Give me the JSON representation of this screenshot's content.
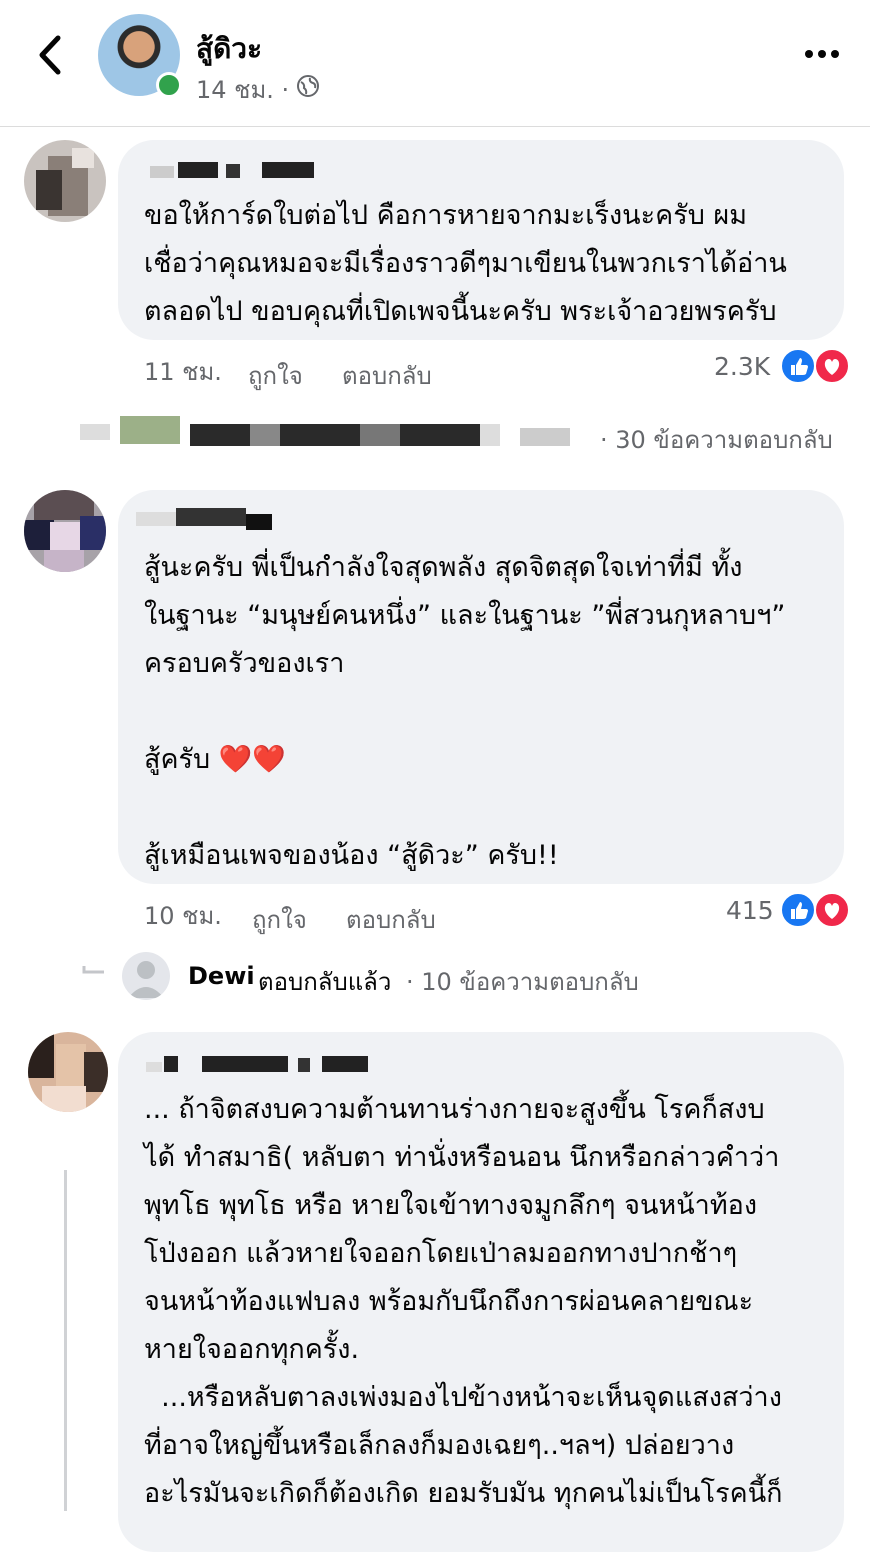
{
  "header": {
    "author": "สู้ดิวะ",
    "time": "14 ชม.",
    "dot": "·"
  },
  "comments": [
    {
      "text": "ขอให้การ์ดใบต่อไป คือการหายจากมะเร็งนะครับ ผม\nเชื่อว่าคุณหมอจะมีเรื่องราวดีๆมาเขียนในพวกเราได้อ่าน\nตลอดไป ขอบคุณที่เปิดเพจนี้นะครับ พระเจ้าอวยพรครับ",
      "time": "11 ชม.",
      "like_label": "ถูกใจ",
      "reply_label": "ตอบกลับ",
      "reactions_count": "2.3K",
      "replies_summary": "· 30 ข้อความตอบกลับ"
    },
    {
      "text": "สู้นะครับ พี่เป็นกำลังใจสุดพลัง สุดจิตสุดใจเท่าที่มี ทั้ง\nในฐานะ “มนุษย์คนหนึ่ง” และในฐานะ ”พี่สวนกุหลาบฯ”\nครอบครัวของเรา\n\nสู้ครับ ❤️❤️\n\nสู้เหมือนเพจของน้อง “สู้ดิวะ” ครับ!!",
      "time": "10 ชม.",
      "like_label": "ถูกใจ",
      "reply_label": "ตอบกลับ",
      "reactions_count": "415",
      "reply_author": "Dewi",
      "reply_action": "ตอบกลับแล้ว",
      "replies_summary": "· 10 ข้อความตอบกลับ"
    },
    {
      "text": "... ถ้าจิตสงบความต้านทานร่างกายจะสูงขึ้น โรคก็สงบ\nได้ ทำสมาธิ( หลับตา ท่านั่งหรือนอน นึกหรือกล่าวคำว่า\nพุทโธ พุทโธ หรือ หายใจเข้าทางจมูกลึกๆ จนหน้าท้อง\nโป่งออก แล้วหายใจออกโดยเป่าลมออกทางปากช้าๆ\nจนหน้าท้องแฟบลง พร้อมกับนึกถึงการผ่อนคลายขณะ\nหายใจออกทุกครั้ง.\n  ...หรือหลับตาลงเพ่งมองไปข้างหน้าจะเห็นจุดแสงสว่าง\nที่อาจใหญ่ขึ้นหรือเล็กลงก็มองเฉยๆ..ฯลฯ) ปล่อยวาง\nอะไรมันจะเกิดก็ต้องเกิด ยอมรับมัน ทุกคนไม่เป็นโรคนี้ก็"
    }
  ],
  "colors": {
    "bubble": "#f0f2f5",
    "secondary_text": "#65676b",
    "like": "#1877f2",
    "love": "#f0284a",
    "online": "#31a24c"
  },
  "icons": [
    "back-arrow-icon",
    "globe-icon",
    "more-icon",
    "like-reaction-icon",
    "love-reaction-icon",
    "default-avatar-icon",
    "reply-arrow-icon"
  ]
}
